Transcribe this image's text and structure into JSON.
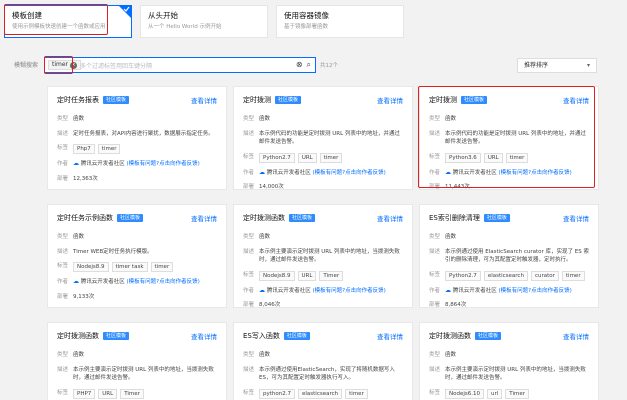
{
  "create_options": [
    {
      "title": "模板创建",
      "desc": "使用示例模板快速创建一个函数或应用"
    },
    {
      "title": "从头开始",
      "desc": "从一个 Hello World 示例开始"
    },
    {
      "title": "使用容器镜像",
      "desc": "基于镜像部署函数"
    }
  ],
  "filter": {
    "label": "模糊搜索",
    "tag": "timer",
    "placeholder": "多个过滤标签用回车键分隔",
    "count": "共12个",
    "sort": "推荐排序"
  },
  "cards": [
    {
      "name": "定时任务报表",
      "badge": "社区模板",
      "more": "查看详情",
      "type_label": "类型",
      "type": "函数",
      "desc_label": "描述",
      "desc": "定时任务报表，对API内容进行聚扰，数据展示指定任务。",
      "tags_label": "标签",
      "tags": [
        "Php7",
        "timer"
      ],
      "author_label": "作者",
      "author": "腾讯云开发者社区",
      "author_link": "(模板有问题?点击向作者反馈)",
      "deploy_label": "部署",
      "deploys": "12,363次"
    },
    {
      "name": "定时拨测",
      "badge": "社区模板",
      "more": "查看详情",
      "type_label": "类型",
      "type": "函数",
      "desc_label": "描述",
      "desc": "本示例代码的功能是定时拨测 URL 列表中的地址，并通过邮件发送告警。",
      "tags_label": "标签",
      "tags": [
        "Python2.7",
        "URL",
        "timer"
      ],
      "author_label": "作者",
      "author": "腾讯云开发者社区",
      "author_link": "(模板有问题?点击向作者反馈)",
      "deploy_label": "部署",
      "deploys": "14,000次"
    },
    {
      "name": "定时拨测",
      "badge": "社区模板",
      "more": "查看详情",
      "type_label": "类型",
      "type": "函数",
      "desc_label": "描述",
      "desc": "本示例代码的功能是定时拨测 URL 列表中的地址，并通过邮件发送告警。",
      "tags_label": "标签",
      "tags": [
        "Python3.6",
        "URL",
        "timer"
      ],
      "author_label": "作者",
      "author": "腾讯云开发者社区",
      "author_link": "(模板有问题?点击向作者反馈)",
      "deploy_label": "部署",
      "deploys": "11,443次"
    },
    {
      "name": "定时任务示例函数",
      "badge": "社区模板",
      "more": "查看详情",
      "type_label": "类型",
      "type": "函数",
      "desc_label": "描述",
      "desc": "Timer WEB定时任务执行模版。",
      "tags_label": "标签",
      "tags": [
        "Nodejs8.9",
        "timer task",
        "timer"
      ],
      "author_label": "作者",
      "author": "腾讯云开发者社区",
      "author_link": "(模板有问题?点击向作者反馈)",
      "deploy_label": "部署",
      "deploys": "9,133次"
    },
    {
      "name": "定时拨测函数",
      "badge": "社区模板",
      "more": "查看详情",
      "type_label": "类型",
      "type": "函数",
      "desc_label": "描述",
      "desc": "本示例主要演示定时拨测 URL 列表中的地址，当拨测失败时，通过邮件发送告警。",
      "tags_label": "标签",
      "tags": [
        "Nodejs8.9",
        "URL",
        "Timer"
      ],
      "author_label": "作者",
      "author": "腾讯云开发者社区",
      "author_link": "(模板有问题?点击向作者反馈)",
      "deploy_label": "部署",
      "deploys": "8,046次"
    },
    {
      "name": "ES索引删除清理",
      "badge": "社区模板",
      "more": "查看详情",
      "type_label": "类型",
      "type": "函数",
      "desc_label": "描述",
      "desc": "本示例通过使用 ElasticSearch curator 库，实现了 ES 索引的删除清理，可为其配置定时触发器，定时执行。",
      "tags_label": "标签",
      "tags": [
        "Python2.7",
        "elasticsearch",
        "curator",
        "timer"
      ],
      "author_label": "作者",
      "author": "腾讯云开发者社区",
      "author_link": "(模板有问题?点击向作者反馈)",
      "deploy_label": "部署",
      "deploys": "8,864次"
    },
    {
      "name": "定时拨测函数",
      "badge": "社区模板",
      "more": "查看详情",
      "type_label": "类型",
      "type": "函数",
      "desc_label": "描述",
      "desc": "本示例主要演示定时拨测 URL 列表中的地址，当拨测失败时，通过邮件发送告警。",
      "tags_label": "标签",
      "tags": [
        "PHP7",
        "URL",
        "Timer"
      ],
      "author_label": "作者",
      "author": "",
      "author_link": "",
      "deploy_label": "",
      "deploys": ""
    },
    {
      "name": "ES写入函数",
      "badge": "社区模板",
      "more": "查看详情",
      "type_label": "类型",
      "type": "函数",
      "desc_label": "描述",
      "desc": "本示例通过使用ElasticSearch，实现了将随机数据写入 ES，可为其配置定时触发器执行写入。",
      "tags_label": "标签",
      "tags": [
        "python2.7",
        "elasticsearch",
        "timer"
      ],
      "author_label": "作者",
      "author": "",
      "author_link": "",
      "deploy_label": "",
      "deploys": ""
    },
    {
      "name": "定时拨测函数",
      "badge": "社区模板",
      "more": "查看详情",
      "type_label": "类型",
      "type": "函数",
      "desc_label": "描述",
      "desc": "本示例主要演示定时拨测 URL 列表中的地址，当拨测失败时，通过邮件发送告警。",
      "tags_label": "标签",
      "tags": [
        "Nodejs6.10",
        "url",
        "Timer"
      ],
      "author_label": "作者",
      "author": "",
      "author_link": "",
      "deploy_label": "",
      "deploys": ""
    }
  ]
}
